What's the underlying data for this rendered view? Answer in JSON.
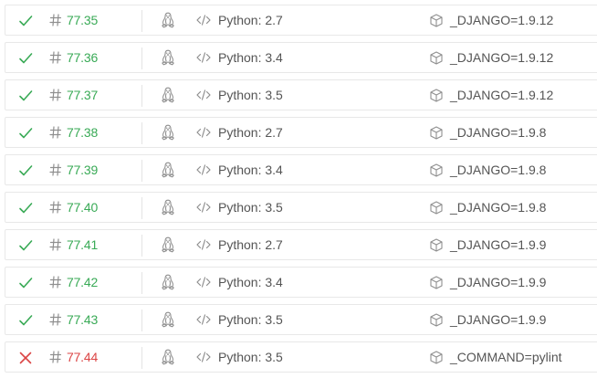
{
  "colors": {
    "passed": "#39aa56",
    "failed": "#db4545",
    "text": "#555555",
    "icon": "#8f8f8f",
    "border": "#e8e8e8"
  },
  "icons": {
    "passed": "checkmark-icon",
    "failed": "cross-icon",
    "hash": "hash-icon",
    "os": "linux-tux-icon",
    "language": "code-icon",
    "env": "package-box-icon"
  },
  "jobs": [
    {
      "status": "passed",
      "number": "77.35",
      "language": "Python: 2.7",
      "env": "_DJANGO=1.9.12"
    },
    {
      "status": "passed",
      "number": "77.36",
      "language": "Python: 3.4",
      "env": "_DJANGO=1.9.12"
    },
    {
      "status": "passed",
      "number": "77.37",
      "language": "Python: 3.5",
      "env": "_DJANGO=1.9.12"
    },
    {
      "status": "passed",
      "number": "77.38",
      "language": "Python: 2.7",
      "env": "_DJANGO=1.9.8"
    },
    {
      "status": "passed",
      "number": "77.39",
      "language": "Python: 3.4",
      "env": "_DJANGO=1.9.8"
    },
    {
      "status": "passed",
      "number": "77.40",
      "language": "Python: 3.5",
      "env": "_DJANGO=1.9.8"
    },
    {
      "status": "passed",
      "number": "77.41",
      "language": "Python: 2.7",
      "env": "_DJANGO=1.9.9"
    },
    {
      "status": "passed",
      "number": "77.42",
      "language": "Python: 3.4",
      "env": "_DJANGO=1.9.9"
    },
    {
      "status": "passed",
      "number": "77.43",
      "language": "Python: 3.5",
      "env": "_DJANGO=1.9.9"
    },
    {
      "status": "failed",
      "number": "77.44",
      "language": "Python: 3.5",
      "env": "_COMMAND=pylint"
    }
  ]
}
